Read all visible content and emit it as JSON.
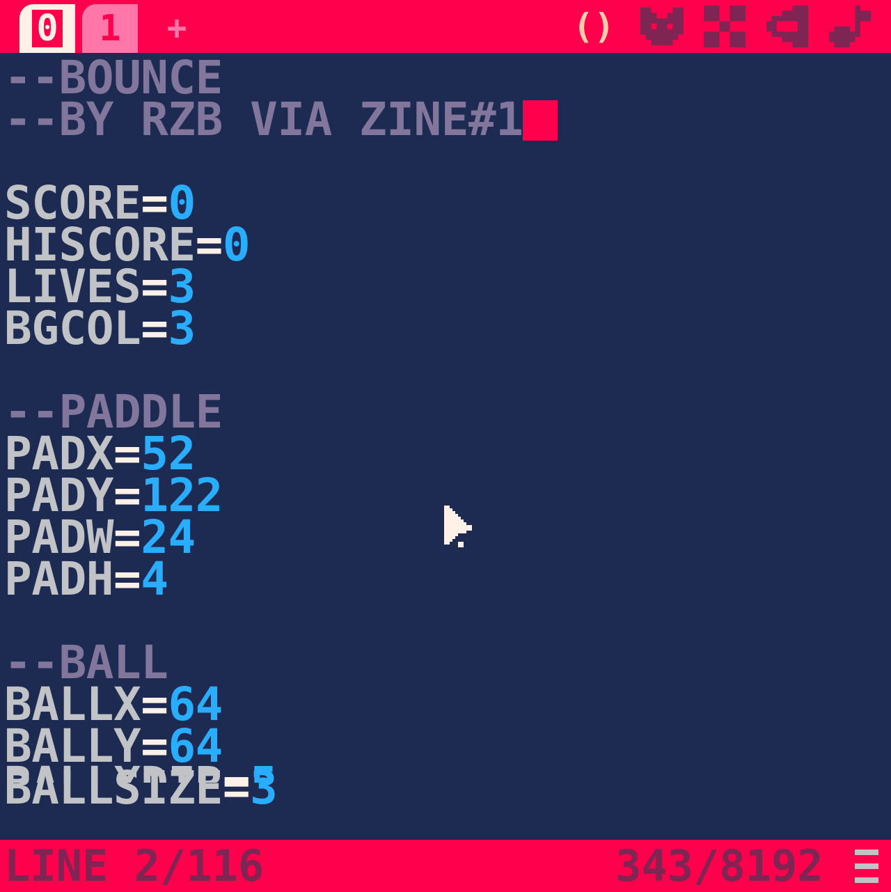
{
  "tabs": [
    {
      "label": "0",
      "active": true
    },
    {
      "label": "1",
      "active": false
    }
  ],
  "add_tab_label": "+",
  "toolbar": {
    "code_icon": "code-braces-icon",
    "code_label": "()",
    "sprite_icon": "sprite-cat-icon",
    "map_icon": "map-grid-icon",
    "sfx_icon": "sfx-speaker-icon",
    "music_icon": "music-note-icon"
  },
  "code": {
    "comment1": "--BOUNCE",
    "comment2": "--BY RZB VIA ZINE#1",
    "score_name": "SCORE",
    "score_val": "0",
    "hiscore_name": "HISCORE",
    "hiscore_val": "0",
    "lives_name": "LIVES",
    "lives_val": "3",
    "bgcol_name": "BGCOL",
    "bgcol_val": "3",
    "comment_paddle": "--PADDLE",
    "padx_name": "PADX",
    "padx_val": "52",
    "pady_name": "PADY",
    "pady_val": "122",
    "padw_name": "PADW",
    "padw_val": "24",
    "padh_name": "PADH",
    "padh_val": "4",
    "comment_ball": "--BALL",
    "ballx_name": "BALLX",
    "ballx_val": "64",
    "bally_name": "BALLY",
    "bally_val": "64",
    "ballsize_name": "BALLSIZE",
    "ballsize_val": "3",
    "ballxdir_name": "BALLXDIR",
    "ballxdir_val": "5",
    "equals": "="
  },
  "status": {
    "line_info": "LINE 2/116",
    "token_info": "343/8192"
  },
  "colors": {
    "accent": "#ff004d",
    "background": "#1d2b53",
    "comment": "#83769c",
    "identifier": "#c2c3c7",
    "number": "#29adff",
    "status_text": "#7e2553"
  }
}
